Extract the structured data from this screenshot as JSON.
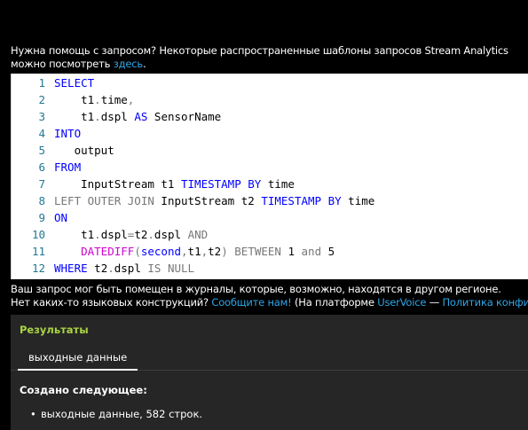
{
  "help": {
    "text": "Нужна помощь с запросом? Некоторые распространенные шаблоны запросов Stream Analytics можно посмотреть ",
    "link": "здесь",
    "end": "."
  },
  "editor": {
    "lines": [
      {
        "n": "1",
        "parts": [
          {
            "t": "SELECT",
            "c": "kw"
          }
        ]
      },
      {
        "n": "2",
        "parts": [
          {
            "t": "    t1",
            "c": ""
          },
          {
            "t": ".",
            "c": "gr"
          },
          {
            "t": "time",
            "c": ""
          },
          {
            "t": ",",
            "c": "gr"
          }
        ]
      },
      {
        "n": "3",
        "parts": [
          {
            "t": "    t1",
            "c": ""
          },
          {
            "t": ".",
            "c": "gr"
          },
          {
            "t": "dspl ",
            "c": ""
          },
          {
            "t": "AS",
            "c": "kw"
          },
          {
            "t": " SensorName",
            "c": ""
          }
        ]
      },
      {
        "n": "4",
        "parts": [
          {
            "t": "INTO",
            "c": "kw"
          }
        ]
      },
      {
        "n": "5",
        "parts": [
          {
            "t": "   output",
            "c": ""
          }
        ]
      },
      {
        "n": "6",
        "parts": [
          {
            "t": "FROM",
            "c": "kw"
          }
        ]
      },
      {
        "n": "7",
        "parts": [
          {
            "t": "    InputStream t1 ",
            "c": ""
          },
          {
            "t": "TIMESTAMP",
            "c": "kw"
          },
          {
            "t": " ",
            "c": ""
          },
          {
            "t": "BY",
            "c": "kw"
          },
          {
            "t": " time",
            "c": ""
          }
        ]
      },
      {
        "n": "8",
        "parts": [
          {
            "t": "LEFT OUTER JOIN",
            "c": "gr"
          },
          {
            "t": " InputStream t2 ",
            "c": ""
          },
          {
            "t": "TIMESTAMP",
            "c": "kw"
          },
          {
            "t": " ",
            "c": ""
          },
          {
            "t": "BY",
            "c": "kw"
          },
          {
            "t": " time",
            "c": ""
          }
        ]
      },
      {
        "n": "9",
        "parts": [
          {
            "t": "ON",
            "c": "kw"
          }
        ]
      },
      {
        "n": "10",
        "parts": [
          {
            "t": "    t1",
            "c": ""
          },
          {
            "t": ".",
            "c": "gr"
          },
          {
            "t": "dspl",
            "c": ""
          },
          {
            "t": "=",
            "c": "gr"
          },
          {
            "t": "t2",
            "c": ""
          },
          {
            "t": ".",
            "c": "gr"
          },
          {
            "t": "dspl ",
            "c": ""
          },
          {
            "t": "AND",
            "c": "gr"
          }
        ]
      },
      {
        "n": "11",
        "parts": [
          {
            "t": "    ",
            "c": ""
          },
          {
            "t": "DATEDIFF",
            "c": "fn"
          },
          {
            "t": "(",
            "c": "gr"
          },
          {
            "t": "second",
            "c": "kw"
          },
          {
            "t": ",",
            "c": "gr"
          },
          {
            "t": "t1",
            "c": ""
          },
          {
            "t": ",",
            "c": "gr"
          },
          {
            "t": "t2",
            "c": ""
          },
          {
            "t": ") ",
            "c": "gr"
          },
          {
            "t": "BETWEEN",
            "c": "gr"
          },
          {
            "t": " 1 ",
            "c": "num"
          },
          {
            "t": "and",
            "c": "gr"
          },
          {
            "t": " 5",
            "c": "num"
          }
        ]
      },
      {
        "n": "12",
        "parts": [
          {
            "t": "WHERE",
            "c": "kw"
          },
          {
            "t": " t2",
            "c": ""
          },
          {
            "t": ".",
            "c": "gr"
          },
          {
            "t": "dspl ",
            "c": ""
          },
          {
            "t": "IS NULL",
            "c": "gr"
          }
        ]
      }
    ]
  },
  "notice": {
    "line1": "Ваш запрос мог быть помещен в журналы, которые, возможно, находятся в другом регионе.",
    "line2_prefix": "Нет каких-то языковых конструкций? ",
    "line2_link1": "Сообщите нам!",
    "line2_mid": " (На платформе ",
    "line2_link2": "UserVoice",
    "line2_dash": " — ",
    "line2_link3": "Политика конфиден..."
  },
  "results": {
    "title": "Результаты",
    "tab_label": "выходные данные",
    "created_label": "Создано следующее:",
    "bullet": "•",
    "item": "выходные данные, 582 строк."
  }
}
